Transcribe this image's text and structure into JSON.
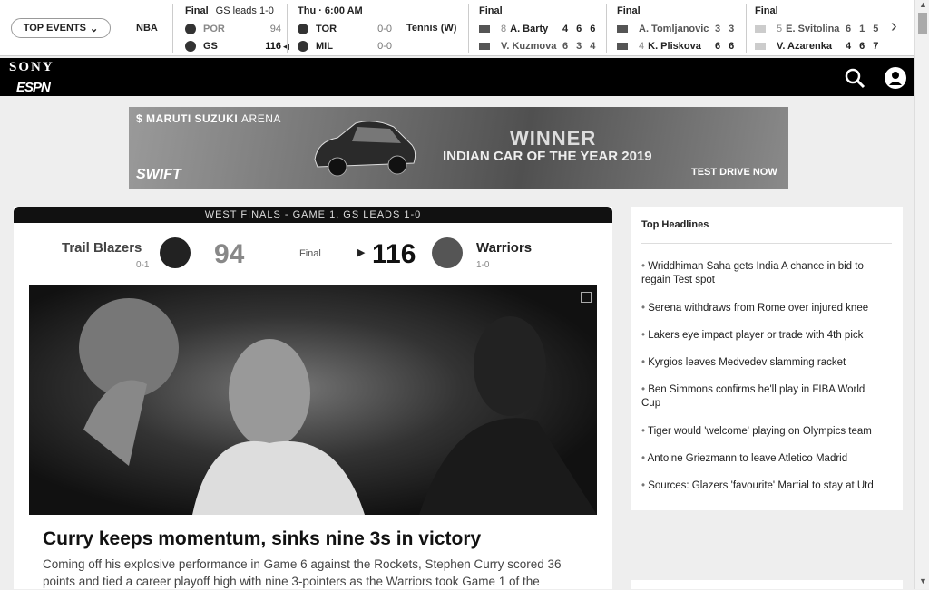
{
  "scorebar": {
    "top_events_label": "TOP EVENTS",
    "sport_nba": "NBA",
    "sport_tennis": "Tennis (W)",
    "games": [
      {
        "status": "Final",
        "note": "GS leads 1-0",
        "home": {
          "team": "POR",
          "score": "94"
        },
        "away": {
          "team": "GS",
          "score": "116"
        }
      },
      {
        "status": "Thu · 6:00 AM",
        "note": "",
        "home": {
          "team": "TOR",
          "score": "0-0"
        },
        "away": {
          "team": "MIL",
          "score": "0-0"
        }
      }
    ],
    "matches": [
      {
        "status": "Final",
        "p1": {
          "seed": "8",
          "name": "A. Barty",
          "sets": [
            "4",
            "6",
            "6"
          ]
        },
        "p2": {
          "seed": "",
          "name": "V. Kuzmova",
          "sets": [
            "6",
            "3",
            "4"
          ]
        }
      },
      {
        "status": "Final",
        "p1": {
          "seed": "",
          "name": "A. Tomljanovic",
          "sets": [
            "3",
            "3"
          ]
        },
        "p2": {
          "seed": "4",
          "name": "K. Pliskova",
          "sets": [
            "6",
            "6"
          ]
        }
      },
      {
        "status": "Final",
        "p1": {
          "seed": "5",
          "name": "E. Svitolina",
          "sets": [
            "6",
            "1",
            "5"
          ]
        },
        "p2": {
          "seed": "",
          "name": "V. Azarenka",
          "sets": [
            "4",
            "6",
            "7"
          ]
        }
      }
    ]
  },
  "header": {
    "brand_top": "SONY",
    "brand_bottom": "ESPN"
  },
  "ad": {
    "brand": "MARUTI SUZUKI",
    "brand_suffix": "ARENA",
    "headline": "WINNER",
    "subline": "INDIAN CAR OF THE YEAR 2019",
    "model": "SWIFT",
    "cta": "TEST DRIVE NOW"
  },
  "game": {
    "strip": "WEST FINALS - GAME 1, GS LEADS 1-0",
    "status": "Final",
    "away": {
      "name": "Trail Blazers",
      "record": "0-1",
      "score": "94"
    },
    "home": {
      "name": "Warriors",
      "record": "1-0",
      "score": "116"
    }
  },
  "story": {
    "headline": "Curry keeps momentum, sinks nine 3s in victory",
    "summary": "Coming off his explosive performance in Game 6 against the Rockets, Stephen Curry scored 36 points and tied a career playoff high with nine 3-pointers as the Warriors took Game 1 of the"
  },
  "sidebar": {
    "title": "Top Headlines",
    "items": [
      "Wriddhiman Saha gets India A chance in bid to regain Test spot",
      "Serena withdraws from Rome over injured knee",
      "Lakers eye impact player or trade with 4th pick",
      "Kyrgios leaves Medvedev slamming racket",
      "Ben Simmons confirms he'll play in FIBA World Cup",
      "Tiger would 'welcome' playing on Olympics team",
      "Antoine Griezmann to leave Atletico Madrid",
      "Sources: Glazers 'favourite' Martial to stay at Utd"
    ]
  },
  "colors": {
    "header_bg": "#000000",
    "page_bg": "#eeeeee",
    "card_bg": "#ffffff"
  }
}
